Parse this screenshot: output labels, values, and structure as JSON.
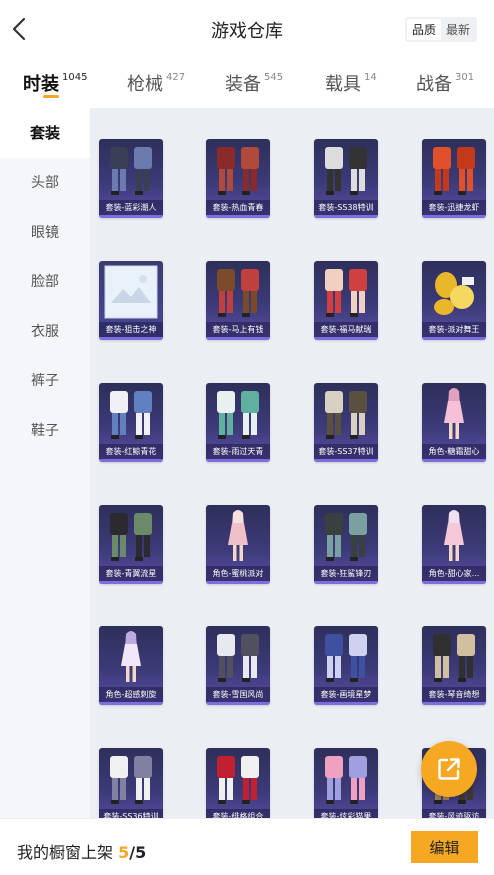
{
  "header": {
    "title": "游戏仓库",
    "sort_options": [
      "品质",
      "最新"
    ],
    "active_sort": 0
  },
  "tabs": [
    {
      "label": "时装",
      "count": "1045",
      "active": true
    },
    {
      "label": "枪械",
      "count": "427",
      "active": false
    },
    {
      "label": "装备",
      "count": "545",
      "active": false
    },
    {
      "label": "载具",
      "count": "14",
      "active": false
    },
    {
      "label": "战备",
      "count": "301",
      "active": false
    }
  ],
  "sidebar": {
    "items": [
      "套装",
      "头部",
      "眼镜",
      "脸部",
      "衣服",
      "裤子",
      "鞋子"
    ],
    "active": 0
  },
  "items": [
    {
      "label": "套装-蓝彩潮人",
      "icon": "outfit-icon",
      "palette": [
        "#3a3f55",
        "#6b7bb0"
      ]
    },
    {
      "label": "套装-热血青春",
      "icon": "outfit-icon",
      "palette": [
        "#8a2a2a",
        "#b04a3a"
      ]
    },
    {
      "label": "套装-SS38特训",
      "icon": "outfit-icon",
      "palette": [
        "#dddddd",
        "#333333"
      ]
    },
    {
      "label": "套装-迅捷龙虾",
      "icon": "outfit-icon",
      "palette": [
        "#e0502a",
        "#c23a1a"
      ]
    },
    {
      "label": "套装-狙击之神",
      "icon": "image-placeholder-icon",
      "palette": [
        "#e9f2fb",
        "#c9d6e6"
      ]
    },
    {
      "label": "套装-马上有钱",
      "icon": "outfit-icon",
      "palette": [
        "#7a4a2a",
        "#c04040"
      ]
    },
    {
      "label": "套装-福马献瑞",
      "icon": "outfit-icon",
      "palette": [
        "#f0d0c0",
        "#d04040"
      ]
    },
    {
      "label": "套装-派对舞王",
      "icon": "gold-outfit-icon",
      "palette": [
        "#e8b82a",
        "#f5d860"
      ]
    },
    {
      "label": "套装-红鲸青花",
      "icon": "outfit-icon",
      "palette": [
        "#f0f0f5",
        "#6080c0"
      ]
    },
    {
      "label": "套装-雨过天青",
      "icon": "outfit-icon",
      "palette": [
        "#e8f0f0",
        "#60b0a0"
      ]
    },
    {
      "label": "套装-SS37特训",
      "icon": "outfit-icon",
      "palette": [
        "#d8d0c0",
        "#5a5040"
      ]
    },
    {
      "label": "角色-糖霜甜心",
      "icon": "character-icon",
      "palette": [
        "#f5c0d8",
        "#e0a0c0"
      ]
    },
    {
      "label": "套装-青翼流星",
      "icon": "outfit-icon",
      "palette": [
        "#2a2a30",
        "#6a8a6a"
      ]
    },
    {
      "label": "角色-蜜桃派对",
      "icon": "character-icon",
      "palette": [
        "#f0c0c8",
        "#f8e0e0"
      ]
    },
    {
      "label": "套装-狂鲨锋刃",
      "icon": "outfit-icon",
      "palette": [
        "#3a4040",
        "#7aa0a0"
      ]
    },
    {
      "label": "角色-甜心家...",
      "icon": "character-icon",
      "palette": [
        "#f5c8d8",
        "#f0e0f0"
      ]
    },
    {
      "label": "角色-超感刺旋",
      "icon": "character-icon",
      "palette": [
        "#f0e8f8",
        "#c0a8e0"
      ]
    },
    {
      "label": "套装-雪国风尚",
      "icon": "outfit-icon",
      "palette": [
        "#e8e8f0",
        "#505060"
      ]
    },
    {
      "label": "套装-画境星梦",
      "icon": "outfit-icon",
      "palette": [
        "#4050a0",
        "#d0d0f0"
      ]
    },
    {
      "label": "套装-琴音绮想",
      "icon": "outfit-icon",
      "palette": [
        "#303030",
        "#d0c0a0"
      ]
    },
    {
      "label": "套装-SS36特训",
      "icon": "outfit-icon",
      "palette": [
        "#f0f0f0",
        "#8080a0"
      ]
    },
    {
      "label": "套装-绯格组合",
      "icon": "outfit-icon",
      "palette": [
        "#c02030",
        "#f0f0f0"
      ]
    },
    {
      "label": "套装-炫彩猫果",
      "icon": "outfit-icon",
      "palette": [
        "#f0a0c0",
        "#a0a0e0"
      ]
    },
    {
      "label": "套装-风迹驱访",
      "icon": "outfit-icon",
      "palette": [
        "#403830",
        "#a08060"
      ]
    }
  ],
  "bottom": {
    "showcase_label": "我的橱窗上架",
    "showcase_current": "5",
    "showcase_sep": "/",
    "showcase_max": "5",
    "edit_label": "编辑"
  },
  "colors": {
    "accent": "#f7a823",
    "card_bg": "#3c3a78",
    "page_bg": "#ebeef3"
  }
}
